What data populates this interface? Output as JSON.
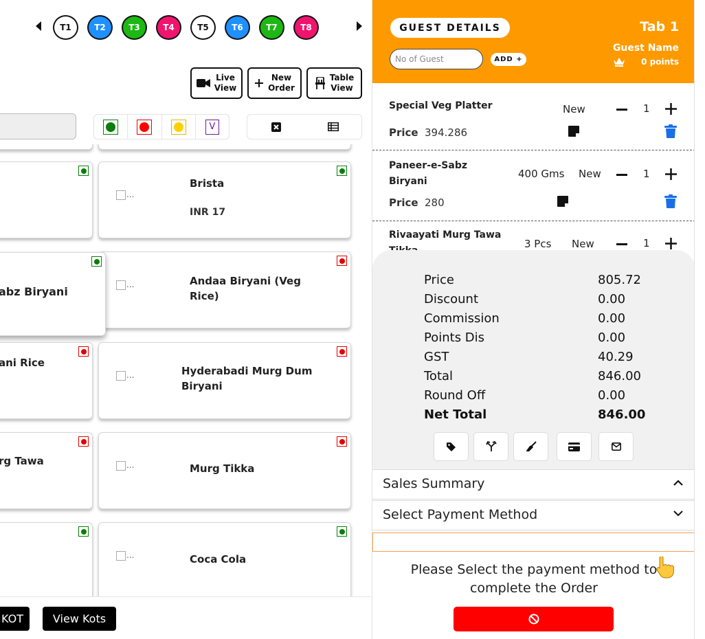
{
  "tables": [
    {
      "label": "T1",
      "bg": "#ffffff",
      "fg": "#111111"
    },
    {
      "label": "T2",
      "bg": "#1e90ff",
      "fg": "#ffffff"
    },
    {
      "label": "T3",
      "bg": "#1db813",
      "fg": "#ffffff"
    },
    {
      "label": "T4",
      "bg": "#f0146e",
      "fg": "#ffffff"
    },
    {
      "label": "T5",
      "bg": "#ffffff",
      "fg": "#111111"
    },
    {
      "label": "T6",
      "bg": "#1e90ff",
      "fg": "#ffffff"
    },
    {
      "label": "T7",
      "bg": "#1db813",
      "fg": "#ffffff"
    },
    {
      "label": "T8",
      "bg": "#f0146e",
      "fg": "#ffffff"
    }
  ],
  "views": {
    "live": {
      "line1": "Live",
      "line2": "View"
    },
    "new_order": {
      "line1": "New",
      "line2": "Order"
    },
    "table": {
      "line1": "Table",
      "line2": "View"
    }
  },
  "filters": {
    "v_label": "V"
  },
  "products": {
    "broken_img": "...",
    "items": [
      {
        "name": "Brista",
        "price": "INR 17",
        "veg": true
      },
      {
        "name": "abz Biryani",
        "veg": true
      },
      {
        "name": "Andaa Biryani (Veg Rice)",
        "veg": false
      },
      {
        "name": "ani Rice",
        "veg": false
      },
      {
        "name": "Hyderabadi Murg Dum Biryani",
        "veg": false
      },
      {
        "name": "rg Tawa",
        "veg": false
      },
      {
        "name": "Murg Tikka",
        "veg": false
      },
      {
        "name": "Coca Cola",
        "veg": true
      }
    ]
  },
  "bottom": {
    "kot_label": "KOT",
    "view_kots_label": "View Kots"
  },
  "header": {
    "guest_details_label": "GUEST DETAILS",
    "tab_label": "Tab 1",
    "guest_placeholder": "No of Guest",
    "add_label": "ADD +",
    "guest_name": "Guest Name",
    "points": "0 points"
  },
  "order": {
    "price_label": "Price",
    "items": [
      {
        "name": "Special Veg Platter",
        "qty_label": "",
        "status": "New",
        "count": "1",
        "price": "394.286"
      },
      {
        "name": "Paneer-e-Sabz Biryani",
        "qty_label": "400 Gms",
        "status": "New",
        "count": "1",
        "price": "280"
      },
      {
        "name": "Rivaayati Murg Tawa Tikka",
        "qty_label": "3 Pcs",
        "status": "New",
        "count": "1",
        "price": ""
      }
    ]
  },
  "summary": [
    {
      "label": "Price",
      "value": "805.72"
    },
    {
      "label": "Discount",
      "value": "0.00"
    },
    {
      "label": "Commission",
      "value": "0.00"
    },
    {
      "label": "Points Dis",
      "value": "0.00"
    },
    {
      "label": "GST",
      "value": "40.29"
    },
    {
      "label": "Total",
      "value": "846.00"
    },
    {
      "label": "Round Off",
      "value": "0.00"
    },
    {
      "label": "Net Total",
      "value": "846.00"
    }
  ],
  "sales_summary_label": "Sales Summary",
  "payment_method_label": "Select Payment Method",
  "payment_message": "Please Select the payment method to complete the Order",
  "colors": {
    "accent": "#fe9a00",
    "veg": "#0a7d0a",
    "nonveg": "#e00000",
    "danger": "#ff0000",
    "trash": "#1a6fe8"
  }
}
